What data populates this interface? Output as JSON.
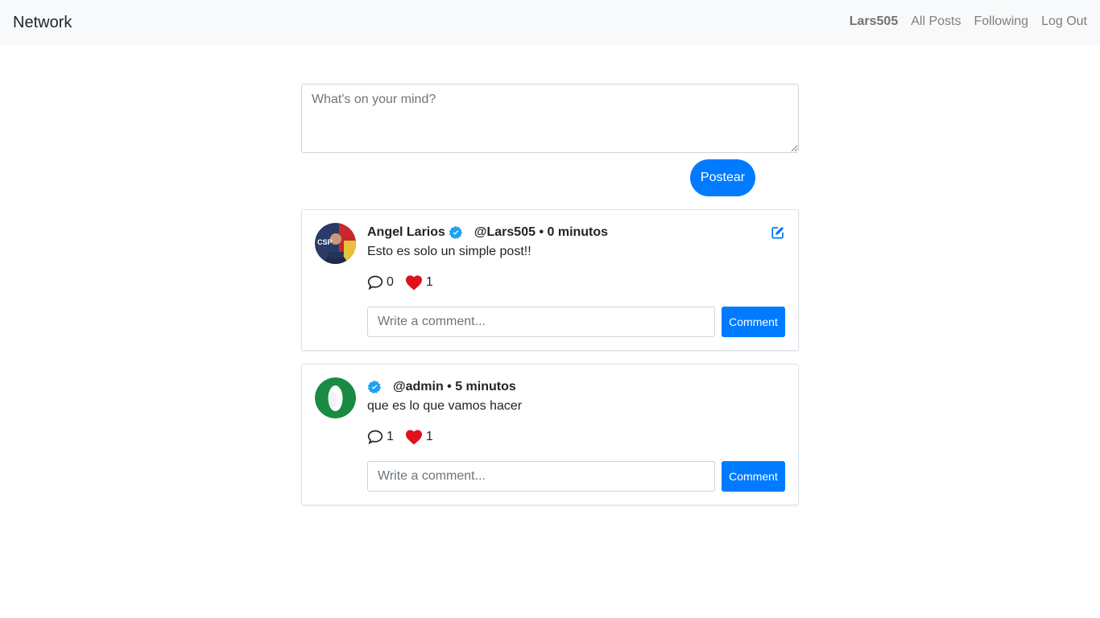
{
  "navbar": {
    "brand": "Network",
    "links": [
      {
        "label": "Lars505"
      },
      {
        "label": "All Posts"
      },
      {
        "label": "Following"
      },
      {
        "label": "Log Out"
      }
    ]
  },
  "composer": {
    "placeholder": "What's on your mind?",
    "submit_label": "Postear"
  },
  "colors": {
    "primary": "#007bff",
    "verified": "#1da1f2",
    "heart": "#e0111b",
    "navbar_bg": "#f8f9fa"
  },
  "posts": [
    {
      "display_name": "Angel Larios",
      "handle_time": "@Lars505 • 0 minutos",
      "content": "Esto es solo un simple post!!",
      "comments_count": "0",
      "likes_count": "1",
      "comment_placeholder": "Write a comment...",
      "comment_button": "Comment",
      "editable": true,
      "avatar_icon": "profile-photo"
    },
    {
      "display_name": "",
      "handle_time": "@admin • 5 minutos",
      "content": "que es lo que vamos hacer",
      "comments_count": "1",
      "likes_count": "1",
      "comment_placeholder": "Write a comment...",
      "comment_button": "Comment",
      "editable": false,
      "avatar_icon": "letter-o-logo"
    }
  ]
}
